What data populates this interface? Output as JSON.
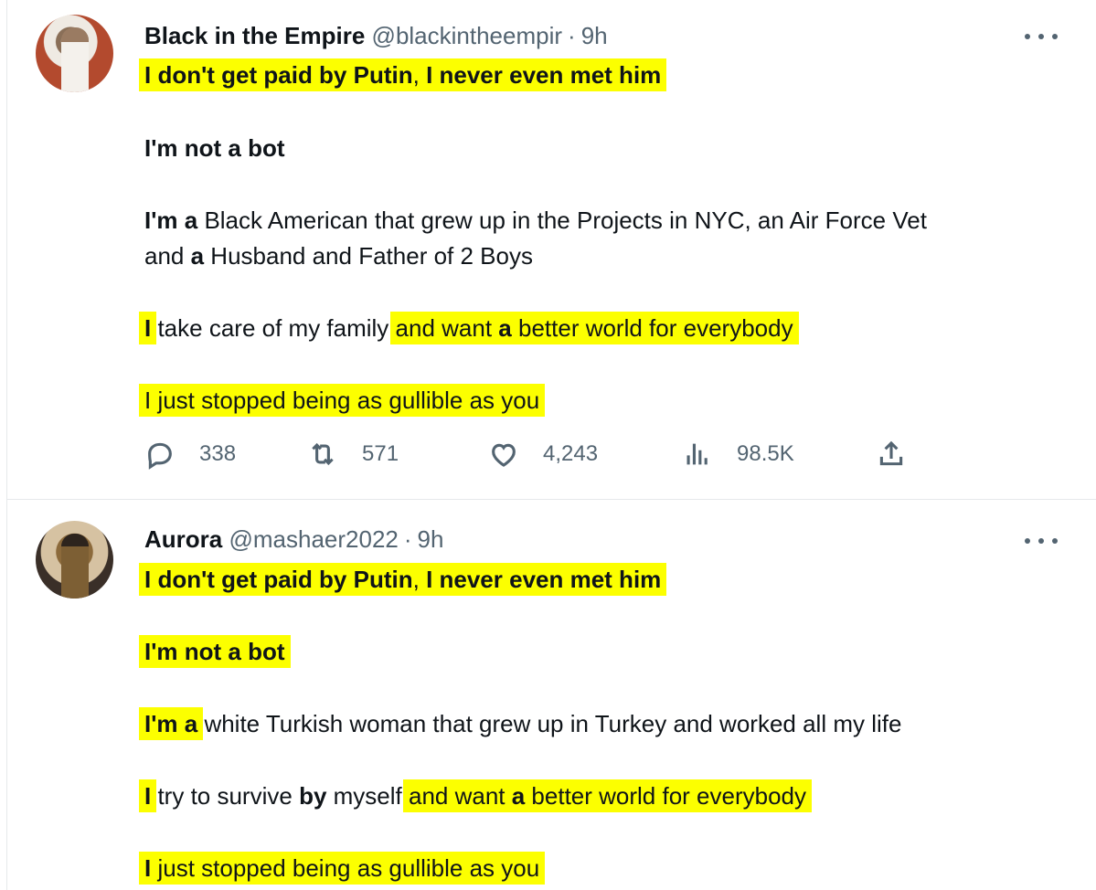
{
  "tweets": [
    {
      "name": "Black in the Empire",
      "handle": "@blackintheempir",
      "separator": "·",
      "time": "9h",
      "lines": [
        {
          "segments": [
            {
              "t": "I don't get paid by Putin",
              "b": true,
              "h": true
            },
            {
              "t": ", ",
              "b": false,
              "h": true
            },
            {
              "t": "I never even met him",
              "b": true,
              "h": true
            }
          ]
        },
        {
          "segments": [
            {
              "t": "I'm not a bot",
              "b": true,
              "h": false
            }
          ]
        },
        {
          "segments": [
            {
              "t": "I'm a",
              "b": true,
              "h": false
            },
            {
              "t": " Black American that grew up in the Projects in NYC, an Air Force Vet",
              "b": false,
              "h": false
            }
          ]
        },
        {
          "segments": [
            {
              "t": "and ",
              "b": false,
              "h": false
            },
            {
              "t": "a",
              "b": true,
              "h": false
            },
            {
              "t": " Husband and Father of 2 Boys",
              "b": false,
              "h": false
            }
          ]
        },
        {
          "segments": [
            {
              "t": "I",
              "b": true,
              "h": true
            },
            {
              "t": " take care of my family ",
              "b": false,
              "h": false
            },
            {
              "t": "and want ",
              "b": false,
              "h": true
            },
            {
              "t": "a",
              "b": true,
              "h": true
            },
            {
              "t": " better world for everybody",
              "b": false,
              "h": true
            }
          ]
        },
        {
          "segments": [
            {
              "t": "I just stopped being as gullible as you",
              "b": false,
              "h": true
            }
          ]
        }
      ],
      "stats": {
        "replies": "338",
        "retweets": "571",
        "likes": "4,243",
        "views": "98.5K"
      }
    },
    {
      "name": "Aurora",
      "handle": "@mashaer2022",
      "separator": "·",
      "time": "9h",
      "lines": [
        {
          "segments": [
            {
              "t": "I don't get paid by Putin",
              "b": true,
              "h": true
            },
            {
              "t": ", ",
              "b": false,
              "h": true
            },
            {
              "t": "I never even met him",
              "b": true,
              "h": true
            }
          ]
        },
        {
          "segments": [
            {
              "t": "I'm not a bot",
              "b": true,
              "h": true
            }
          ]
        },
        {
          "segments": [
            {
              "t": "I'm a",
              "b": true,
              "h": true
            },
            {
              "t": " white Turkish woman that grew up in Turkey and worked all my life",
              "b": false,
              "h": false
            }
          ]
        },
        {
          "segments": [
            {
              "t": "I",
              "b": true,
              "h": true
            },
            {
              "t": " try to survive ",
              "b": false,
              "h": false
            },
            {
              "t": "by",
              "b": true,
              "h": false
            },
            {
              "t": " myself ",
              "b": false,
              "h": false
            },
            {
              "t": "and want ",
              "b": false,
              "h": true
            },
            {
              "t": "a",
              "b": true,
              "h": true
            },
            {
              "t": " better world for everybody",
              "b": false,
              "h": true
            }
          ]
        },
        {
          "segments": [
            {
              "t": "I",
              "b": true,
              "h": true
            },
            {
              "t": " just stopped being as gullible as you",
              "b": false,
              "h": true
            }
          ]
        }
      ]
    }
  ],
  "colors": {
    "highlight": "#fcff00",
    "secondary_text": "#536471",
    "primary_text": "#0f1419"
  },
  "icons": [
    "more-icon",
    "reply-icon",
    "retweet-icon",
    "like-icon",
    "views-icon",
    "share-icon"
  ]
}
